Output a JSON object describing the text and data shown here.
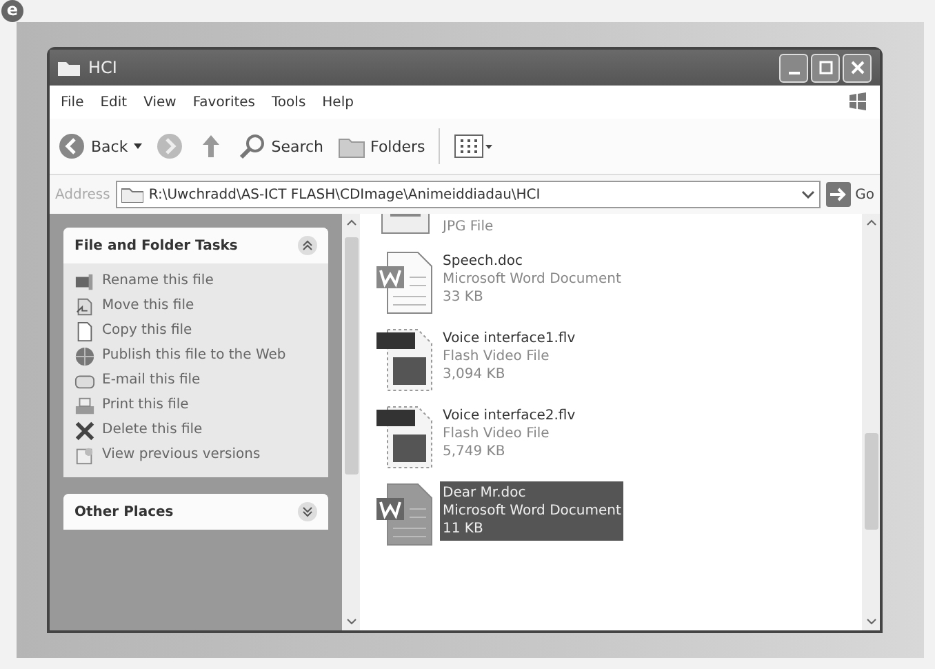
{
  "figure_label": "e",
  "window": {
    "title": "HCI"
  },
  "menu": [
    "File",
    "Edit",
    "View",
    "Favorites",
    "Tools",
    "Help"
  ],
  "toolbar": {
    "back": "Back",
    "search": "Search",
    "folders": "Folders"
  },
  "address": {
    "label": "Address",
    "value": "R:\\Uwchradd\\AS-ICT FLASH\\CDImage\\Animeiddiadau\\HCI",
    "go": "Go"
  },
  "task_panel": {
    "title": "File and Folder Tasks",
    "expanded": true,
    "items": [
      {
        "label": "Rename this file"
      },
      {
        "label": "Move this file"
      },
      {
        "label": "Copy this file"
      },
      {
        "label": "Publish this file to the Web"
      },
      {
        "label": "E-mail this file"
      },
      {
        "label": "Print this file"
      },
      {
        "label": "Delete this file"
      },
      {
        "label": "View previous versions"
      }
    ]
  },
  "other_panel": {
    "title": "Other Places",
    "expanded": false
  },
  "files": [
    {
      "kind": "image",
      "type": "JPG File",
      "selected": false
    },
    {
      "kind": "word",
      "name": "Speech.doc",
      "type": "Microsoft Word Document",
      "size": "33 KB",
      "selected": false
    },
    {
      "kind": "flv",
      "name": "Voice interface1.flv",
      "type": "Flash Video File",
      "size": "3,094 KB",
      "selected": false
    },
    {
      "kind": "flv",
      "name": "Voice interface2.flv",
      "type": "Flash Video File",
      "size": "5,749 KB",
      "selected": false
    },
    {
      "kind": "word",
      "name": "Dear Mr.doc",
      "type": "Microsoft Word Document",
      "size": "11 KB",
      "selected": true
    }
  ]
}
